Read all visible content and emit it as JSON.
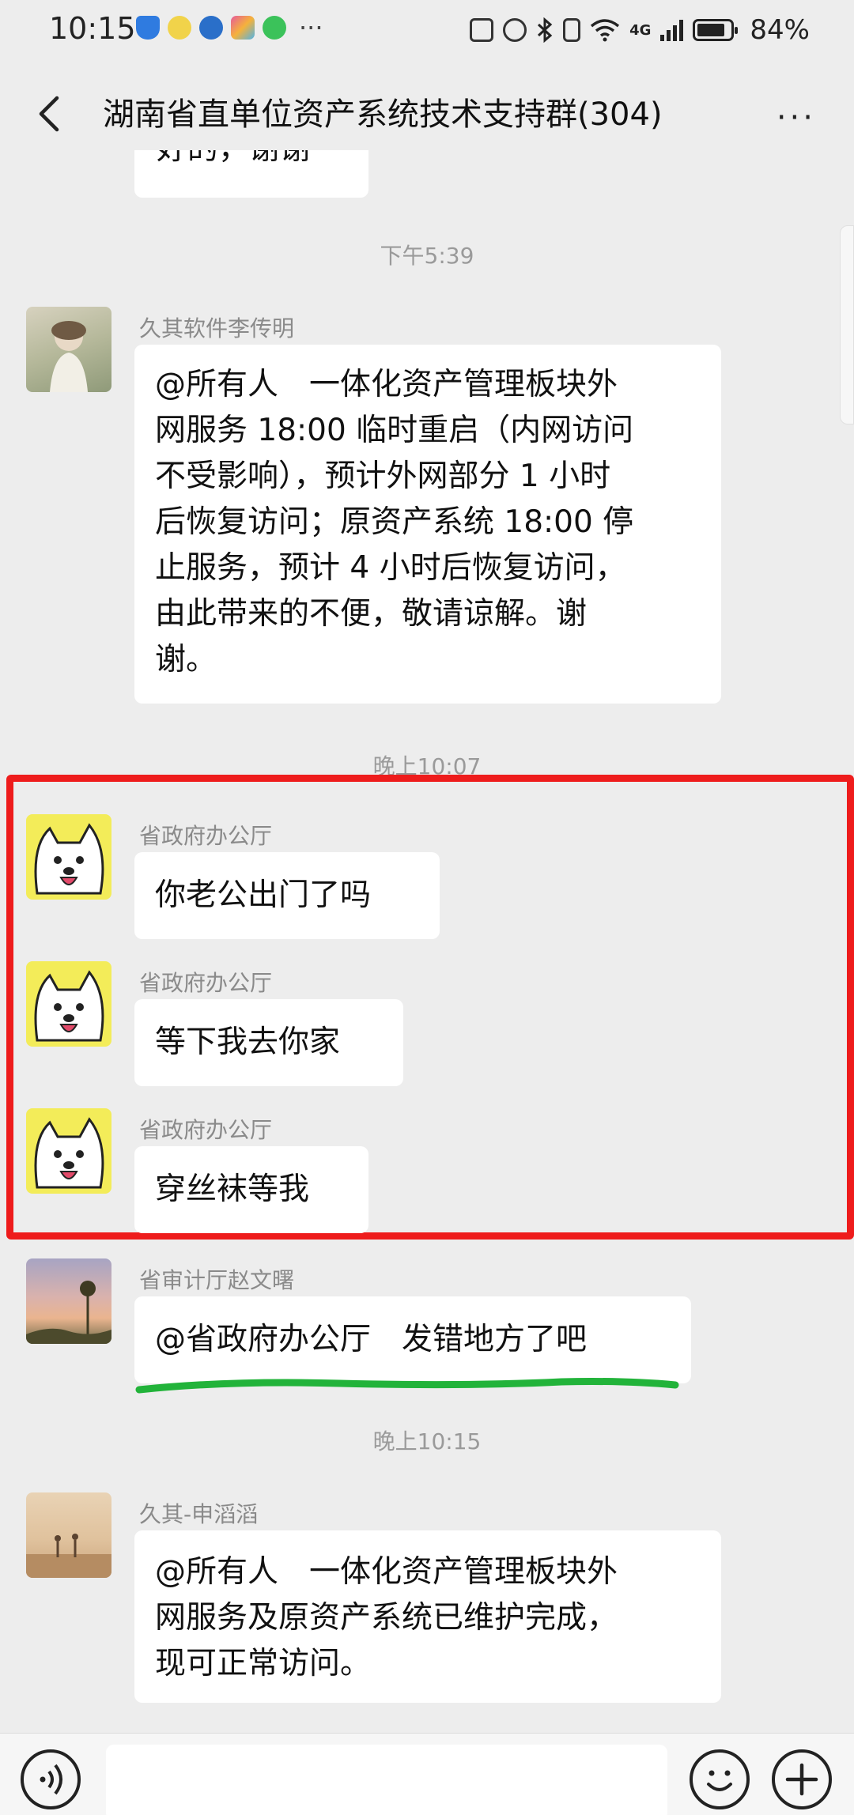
{
  "status_bar": {
    "time": "10:15",
    "more": "···",
    "network": "4G",
    "battery_text": "84%",
    "battery_level": 0.84,
    "left_icons": [
      "shield-icon",
      "app-icon-yellow",
      "app-icon-blue",
      "app-icon-colorful",
      "app-icon-green"
    ],
    "right_icons": [
      "nfc-icon",
      "alarm-icon",
      "bluetooth-icon",
      "vibrate-icon",
      "wifi-icon",
      "signal-icon",
      "battery-icon"
    ]
  },
  "nav": {
    "title": "湖南省直单位资产系统技术支持群(304)",
    "more": "···"
  },
  "messages": {
    "cut_text": "好的，谢谢",
    "time1": "下午5:39",
    "msg1": {
      "sender": "久其软件李传明",
      "lines": [
        "@所有人　一体化资产管理板块外",
        "网服务 18:00 临时重启（内网访问",
        "不受影响），预计外网部分 1 小时",
        "后恢复访问；原资产系统 18:00 停",
        "止服务，预计 4 小时后恢复访问，",
        "由此带来的不便，敬请谅解。谢",
        "谢。"
      ]
    },
    "time2": "晚上10:07",
    "msg2": {
      "sender": "省政府办公厅",
      "text": "你老公出门了吗"
    },
    "msg3": {
      "sender": "省政府办公厅",
      "text": "等下我去你家"
    },
    "msg4": {
      "sender": "省政府办公厅",
      "text": "穿丝袜等我"
    },
    "msg5": {
      "sender": "省审计厅赵文曙",
      "text": "@省政府办公厅　发错地方了吧"
    },
    "time3": "晚上10:15",
    "msg6": {
      "sender": "久其-申滔滔",
      "lines": [
        "@所有人　一体化资产管理板块外",
        "网服务及原资产系统已维护完成，",
        "现可正常访问。"
      ]
    }
  },
  "colors": {
    "background": "#ededed",
    "bubble": "#ffffff",
    "highlight_box": "#ee1c1c",
    "underline": "#22b33a"
  }
}
